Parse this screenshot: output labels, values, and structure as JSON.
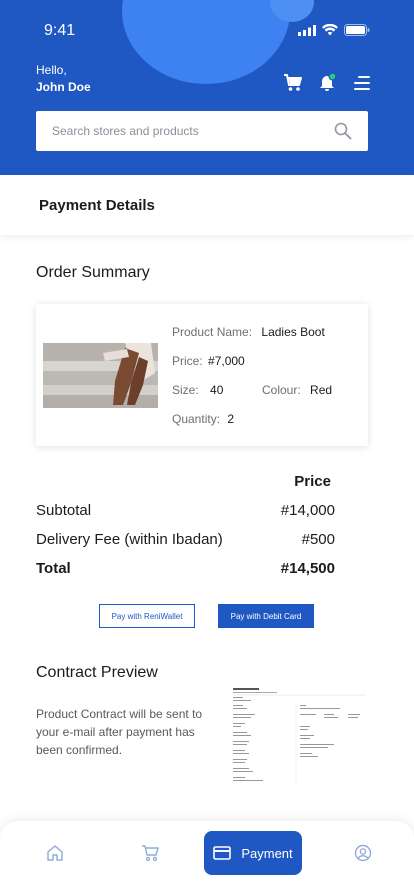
{
  "status_bar": {
    "time": "9:41"
  },
  "header": {
    "greeting": "Hello,",
    "user_name": "John Doe",
    "search": {
      "placeholder": "Search stores and products",
      "value": ""
    }
  },
  "page": {
    "title": "Payment Details"
  },
  "order_summary": {
    "title": "Order Summary",
    "product": {
      "name_label": "Product Name:",
      "name_value": "Ladies Boot",
      "price_label": "Price:",
      "price_value": "#7,000",
      "size_label": "Size:",
      "size_value": "40",
      "colour_label": "Colour:",
      "colour_value": "Red",
      "quantity_label": "Quantity:",
      "quantity_value": "2"
    }
  },
  "pricing": {
    "header": "Price",
    "rows": [
      {
        "label": "Subtotal",
        "value": "#14,000"
      },
      {
        "label": "Delivery Fee (within Ibadan)",
        "value": "#500"
      },
      {
        "label": "Total",
        "value": "#14,500"
      }
    ]
  },
  "actions": {
    "reniwallet_label": "Pay with ReniWallet",
    "debit_card_label": "Pay with Debit Card"
  },
  "contract": {
    "title": "Contract Preview",
    "description": "Product Contract will be sent to your e-mail after payment has been confirmed."
  },
  "bottom_nav": {
    "items": [
      {
        "icon": "home-icon"
      },
      {
        "icon": "cart-icon"
      },
      {
        "icon": "card-icon",
        "label": "Payment",
        "active": true
      },
      {
        "icon": "profile-icon"
      }
    ]
  },
  "colors": {
    "primary": "#1f57c3",
    "header_circle": "#3d82f0",
    "notification_dot": "#2ecc71"
  }
}
